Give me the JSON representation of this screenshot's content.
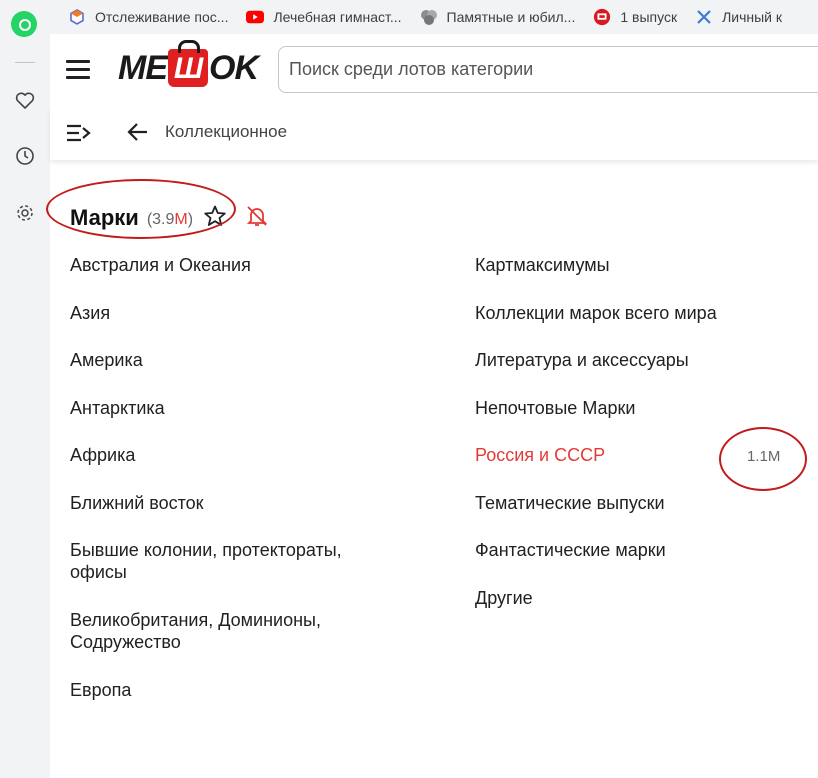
{
  "bookmarks": [
    {
      "label": "Отслеживание пос...",
      "icon": "tracking-icon"
    },
    {
      "label": "Лечебная гимнаст...",
      "icon": "youtube-icon"
    },
    {
      "label": "Памятные и юбил...",
      "icon": "coin-icon"
    },
    {
      "label": "1 выпуск",
      "icon": "badge-icon"
    },
    {
      "label": "Личный к",
      "icon": "personal-icon"
    }
  ],
  "sidebar": {
    "icons": [
      "whatsapp-icon",
      "heart-icon",
      "clock-icon",
      "settings-icon"
    ]
  },
  "header": {
    "logo_left": "ME",
    "logo_bag": "Ш",
    "logo_right": "OK",
    "search_placeholder": "Поиск среди лотов категории"
  },
  "subbar": {
    "breadcrumb": "Коллекционное"
  },
  "category": {
    "title": "Марки",
    "count_open": "(3.9",
    "count_unit": "M",
    "count_close": ")"
  },
  "left_categories": [
    "Австралия и Океания",
    "Азия",
    "Америка",
    "Антарктика",
    "Африка",
    "Ближний восток",
    "Бывшие колонии, протектораты, офисы",
    "Великобритания, Доминионы, Содружество",
    "Европа"
  ],
  "right_categories": [
    "Картмаксимумы",
    "Коллекции марок всего мира",
    "Литература и аксессуары",
    "Непочтовые Марки",
    "Россия и СССР",
    "Тематические выпуски",
    "Фантастические марки",
    "Другие"
  ],
  "highlight": {
    "count": "1.1M"
  },
  "colors": {
    "accent": "#e53935",
    "annotation": "#c21b1b"
  }
}
